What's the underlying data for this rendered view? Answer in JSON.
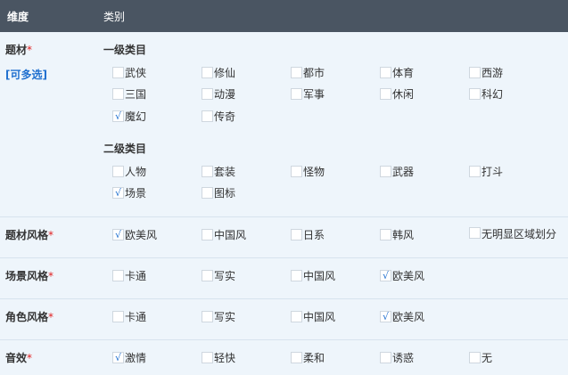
{
  "header": {
    "col_dimension": "维度",
    "col_category": "类别"
  },
  "rows": {
    "theme": {
      "label": "题材",
      "required_mark": "*",
      "multi_note": "[可多选]",
      "primary_title": "一级类目",
      "primary": [
        "武侠",
        "修仙",
        "都市",
        "体育",
        "西游",
        "三国",
        "动漫",
        "军事",
        "休闲",
        "科幻",
        "魔幻",
        "传奇"
      ],
      "primary_checked": [
        false,
        false,
        false,
        false,
        false,
        false,
        false,
        false,
        false,
        false,
        true,
        false
      ],
      "secondary_title": "二级类目",
      "secondary": [
        "人物",
        "套装",
        "怪物",
        "武器",
        "打斗",
        "场景",
        "图标"
      ],
      "secondary_checked": [
        false,
        false,
        false,
        false,
        false,
        true,
        false
      ]
    },
    "theme_style": {
      "label": "题材风格",
      "required_mark": "*",
      "options": [
        "欧美风",
        "中国风",
        "日系",
        "韩风",
        "无明显区域划分"
      ],
      "checked": [
        true,
        false,
        false,
        false,
        false
      ]
    },
    "scene_style": {
      "label": "场景风格",
      "required_mark": "*",
      "options": [
        "卡通",
        "写实",
        "中国风",
        "欧美风"
      ],
      "checked": [
        false,
        false,
        false,
        true
      ]
    },
    "char_style": {
      "label": "角色风格",
      "required_mark": "*",
      "options": [
        "卡通",
        "写实",
        "中国风",
        "欧美风"
      ],
      "checked": [
        false,
        false,
        false,
        true
      ]
    },
    "sound": {
      "label": "音效",
      "required_mark": "*",
      "options": [
        "激情",
        "轻快",
        "柔和",
        "诱惑",
        "无"
      ],
      "checked": [
        true,
        false,
        false,
        false,
        false
      ]
    }
  },
  "check_glyph": "√"
}
